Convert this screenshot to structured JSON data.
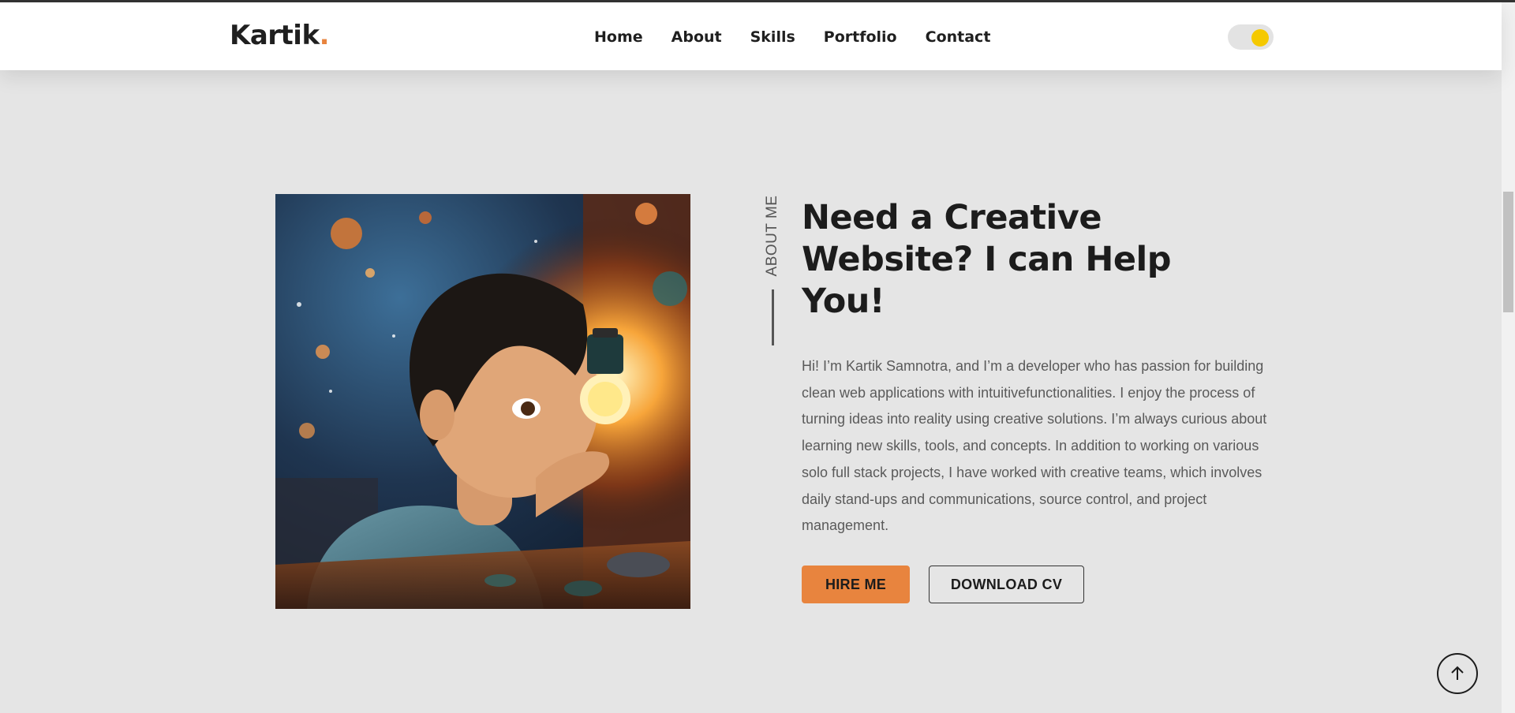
{
  "brand": {
    "logo_text": "Kartik",
    "logo_dot": ".",
    "accent_color": "#e8843e"
  },
  "nav": {
    "items": [
      {
        "label": "Home"
      },
      {
        "label": "About"
      },
      {
        "label": "Skills"
      },
      {
        "label": "Portfolio"
      },
      {
        "label": "Contact"
      }
    ],
    "theme_toggle": {
      "state": "light",
      "knob_color": "#f5c900"
    }
  },
  "about": {
    "section_label": "ABOUT ME",
    "headline": "Need a Creative Website? I can Help You!",
    "bio": "Hi! I’m Kartik Samnotra, and I’m a developer who has passion for building clean web applications with intuitivefunctionalities. I enjoy the process of turning ideas into reality using creative solutions. I’m always curious about learning new skills, tools, and concepts. In addition to working on various solo full stack projects, I have worked with creative teams, which involves daily stand-ups and communications, source control, and project management.",
    "hire_button": "HIRE ME",
    "cv_button": "DOWNLOAD CV",
    "image": {
      "subject": "illustration of a boy looking at a glowing light bulb among planets"
    }
  },
  "scroll_top": {
    "icon": "arrow-up-icon"
  }
}
